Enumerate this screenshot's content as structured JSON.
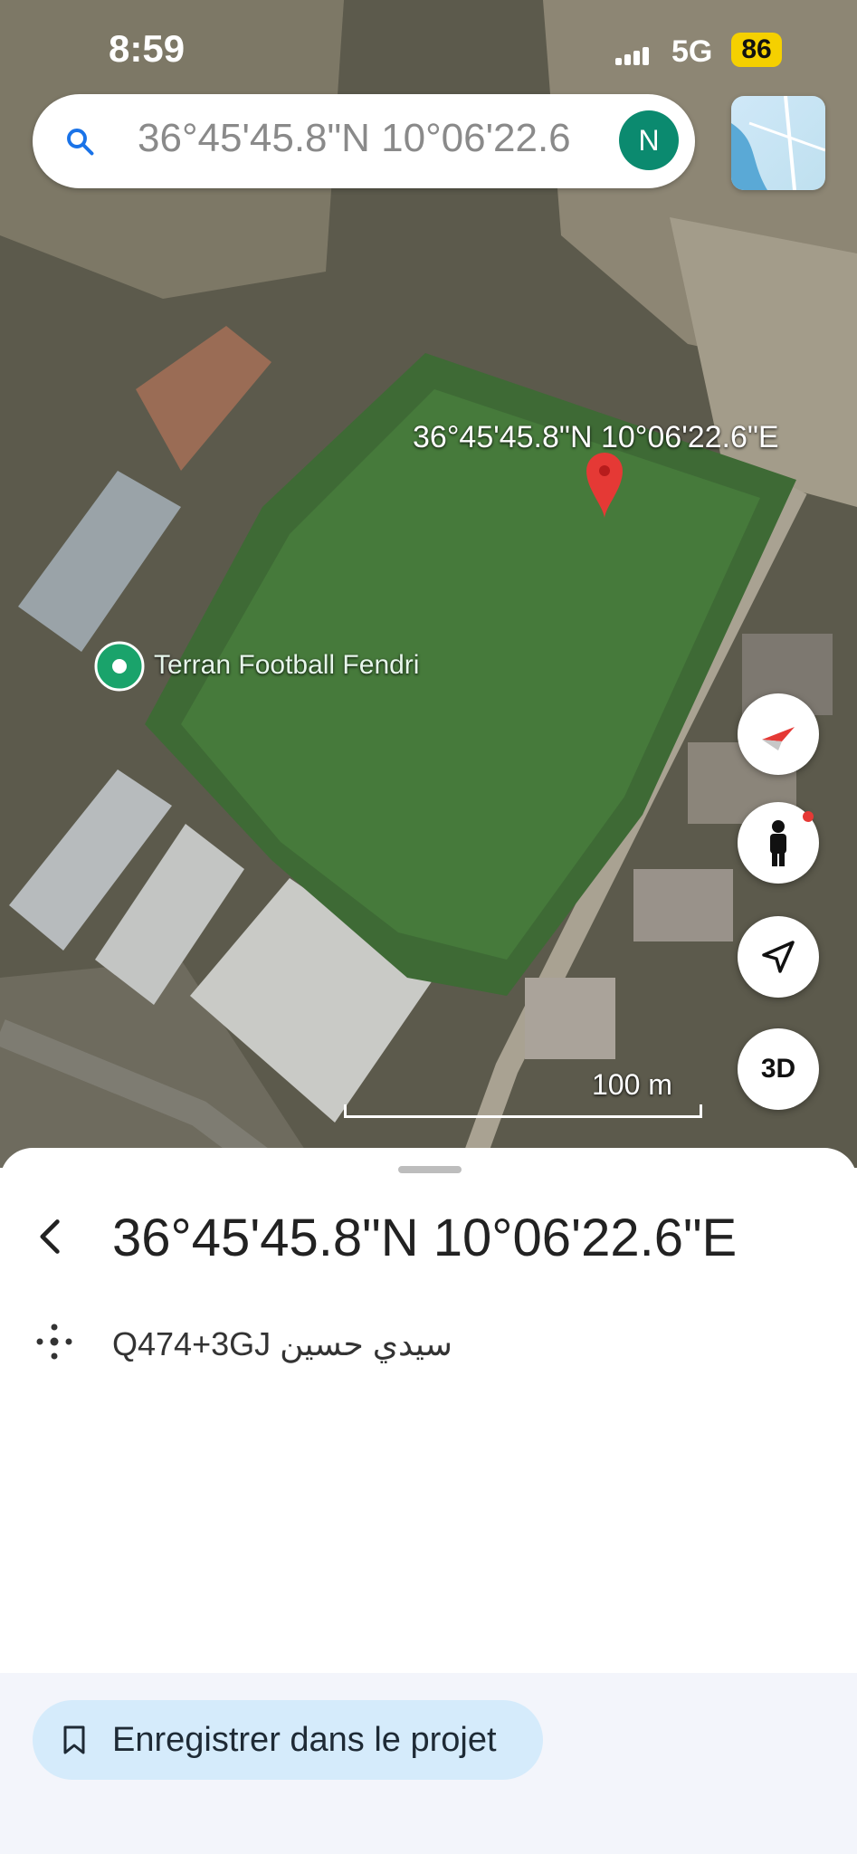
{
  "status_bar": {
    "time": "8:59",
    "network": "5G",
    "battery": "86"
  },
  "search": {
    "query": "36°45'45.8\"N 10°06'22.6",
    "avatar_initial": "N"
  },
  "map": {
    "pin_label": "36°45'45.8\"N 10°06'22.6\"E",
    "place_label": "Terran Football Fendri",
    "scale_label": "100 m",
    "button_3d": "3D"
  },
  "sheet": {
    "title": "36°45'45.8\"N 10°06'22.6\"E",
    "plus_code": "Q474+3GJ سيدي حسين",
    "save_button": "Enregistrer dans le projet"
  },
  "icons": {
    "search": "search-icon",
    "compass": "compass-icon",
    "pegman": "pegman-icon",
    "navigation": "navigation-arrow-icon",
    "back": "chevron-left-icon",
    "plus_code": "plus-code-icon",
    "bookmark": "bookmark-icon"
  },
  "colors": {
    "avatar_bg": "#0b8a6f",
    "pin": "#e53935",
    "place_pin": "#1aa36b",
    "battery_bg": "#f5d000",
    "save_button_bg": "#d5ebfb"
  }
}
